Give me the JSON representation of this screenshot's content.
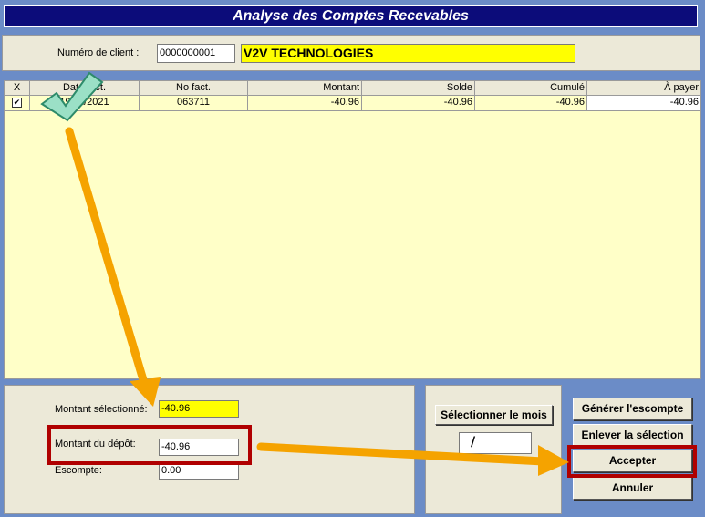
{
  "window": {
    "title": "Analyse des Comptes Recevables"
  },
  "client": {
    "label": "Numéro de client :",
    "number": "0000000001",
    "name": "V2V TECHNOLOGIES"
  },
  "grid": {
    "columns": [
      "X",
      "Date fact.",
      "No fact.",
      "Montant",
      "Solde",
      "Cumulé",
      "À payer"
    ],
    "rows": [
      {
        "checked": "✔",
        "date": "19/11/2021",
        "invoice": "063711",
        "amount": "-40.96",
        "balance": "-40.96",
        "cumul": "-40.96",
        "to_pay": "-40.96"
      }
    ]
  },
  "totals": {
    "selected_label": "Montant sélectionné:",
    "selected_value": "-40.96",
    "deposit_label": "Montant du dépôt:",
    "deposit_value": "-40.96",
    "discount_label": "Escompte:",
    "discount_value": "0.00"
  },
  "month": {
    "button_label": "Sélectionner le mois",
    "value": "/"
  },
  "actions": {
    "generate_label": "Générer l'escompte",
    "remove_label": "Enlever la sélection",
    "accept_label": "Accepter",
    "cancel_label": "Annuler"
  },
  "colors": {
    "title_bg": "#0c0c7a",
    "grid_bg": "#ffffc8",
    "highlight_field": "#ffff00",
    "annotation_arrow": "#f5a300",
    "annotation_box": "#b00000",
    "checkmark": "#5fc9a8"
  }
}
